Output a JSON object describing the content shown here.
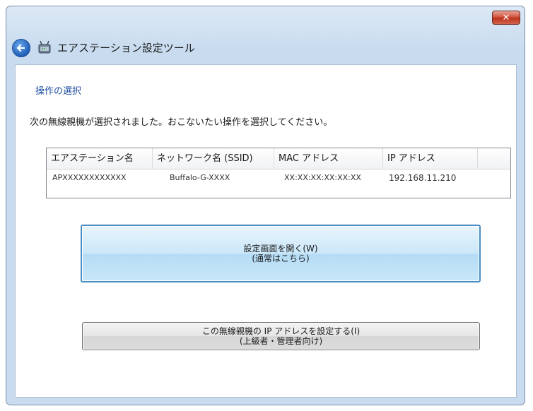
{
  "window": {
    "title": "エアステーション設定ツール",
    "close_glyph": "✕"
  },
  "page": {
    "section_title": "操作の選択",
    "instruction": "次の無線親機が選択されました。おこないたい操作を選択してください。"
  },
  "table": {
    "columns": [
      "エアステーション名",
      "ネットワーク名 (SSID)",
      "MAC アドレス",
      "IP アドレス",
      ""
    ],
    "rows": [
      {
        "name": "APXXXXXXXXXXXX",
        "ssid": "Buffalo-G-XXXX",
        "mac": "XX:XX:XX:XX:XX:XX",
        "ip": "192.168.11.210"
      }
    ]
  },
  "commands": {
    "open_settings": {
      "line1": "設定画面を開く(W)",
      "line2": "(通常はこちら)"
    },
    "set_ip": {
      "line1": "この無線親機の IP アドレスを設定する(I)",
      "line2": "(上級者・管理者向け)"
    }
  },
  "icons": {
    "back": "back-arrow-icon",
    "app": "airstation-icon",
    "close": "close-icon"
  },
  "colors": {
    "accent_link": "#1f4fa0",
    "primary_button": "#b5dcf5",
    "close_button": "#cf4b35"
  }
}
